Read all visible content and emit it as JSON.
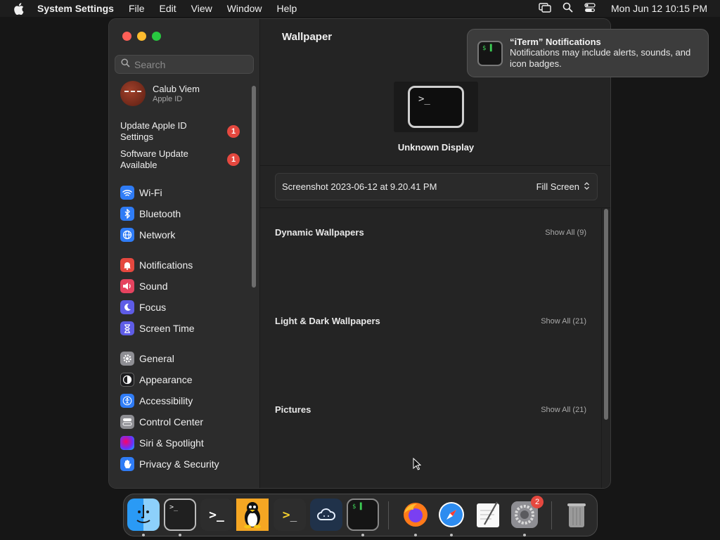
{
  "menubar": {
    "app_name": "System Settings",
    "menus": [
      "File",
      "Edit",
      "View",
      "Window",
      "Help"
    ],
    "clock": "Mon Jun 12  10:15 PM"
  },
  "sidebar": {
    "search_placeholder": "Search",
    "profile": {
      "name": "Calub Viem",
      "subtitle": "Apple ID"
    },
    "alerts": [
      {
        "label": "Update Apple ID Settings",
        "badge": "1"
      },
      {
        "label": "Software Update Available",
        "badge": "1"
      }
    ],
    "items": [
      {
        "label": "Wi-Fi",
        "icon": "wifi-icon",
        "color": "#2f7cf6"
      },
      {
        "label": "Bluetooth",
        "icon": "bluetooth-icon",
        "color": "#2f7cf6"
      },
      {
        "label": "Network",
        "icon": "globe-icon",
        "color": "#2f7cf6"
      },
      {
        "label": "Notifications",
        "icon": "bell-icon",
        "color": "#e5483f"
      },
      {
        "label": "Sound",
        "icon": "speaker-icon",
        "color": "#e5435f"
      },
      {
        "label": "Focus",
        "icon": "moon-icon",
        "color": "#5e5ce6"
      },
      {
        "label": "Screen Time",
        "icon": "hourglass-icon",
        "color": "#5e5ce6"
      },
      {
        "label": "General",
        "icon": "gear-icon",
        "color": "#8e8e93"
      },
      {
        "label": "Appearance",
        "icon": "appearance-icon",
        "color": "#1c1c1e"
      },
      {
        "label": "Accessibility",
        "icon": "accessibility-icon",
        "color": "#2f7cf6"
      },
      {
        "label": "Control Center",
        "icon": "toggles-icon",
        "color": "#8e8e93"
      },
      {
        "label": "Siri & Spotlight",
        "icon": "siri-icon",
        "color": "#b84fd6"
      },
      {
        "label": "Privacy & Security",
        "icon": "hand-icon",
        "color": "#2f7cf6"
      }
    ]
  },
  "main": {
    "title": "Wallpaper",
    "display_label": "Unknown Display",
    "current_wallpaper": "Screenshot 2023-06-12 at 9.20.41 PM",
    "fill_mode": "Fill Screen",
    "sections": [
      {
        "title": "Dynamic Wallpapers",
        "link": "Show All (9)"
      },
      {
        "title": "Light & Dark Wallpapers",
        "link": "Show All (21)"
      },
      {
        "title": "Pictures",
        "link": "Show All (21)"
      }
    ]
  },
  "notification": {
    "title": "“iTerm” Notifications",
    "body": "Notifications may include alerts, sounds, and icon badges."
  },
  "dock": {
    "apps": [
      {
        "name": "finder-icon"
      },
      {
        "name": "terminal-icon"
      },
      {
        "name": "terminal-dark-icon"
      },
      {
        "name": "linux-penguin-icon"
      },
      {
        "name": "powershell-icon"
      },
      {
        "name": "cloud-app-icon"
      },
      {
        "name": "iterm-icon"
      },
      {
        "name": "firefox-icon"
      },
      {
        "name": "safari-icon"
      },
      {
        "name": "textedit-icon"
      },
      {
        "name": "system-settings-icon",
        "badge": "2"
      },
      {
        "name": "trash-icon"
      }
    ]
  }
}
